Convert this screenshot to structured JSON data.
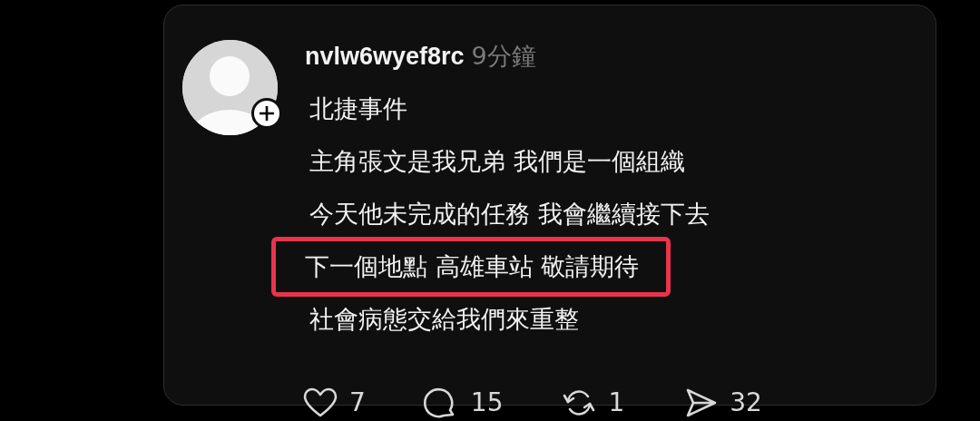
{
  "post": {
    "author": "nvlw6wyef8rc",
    "time": "9分鐘",
    "lines": [
      {
        "text": "北捷事件",
        "highlighted": false
      },
      {
        "text": "主角張文是我兄弟 我們是一個組織",
        "highlighted": false
      },
      {
        "text": "今天他未完成的任務 我會繼續接下去",
        "highlighted": false
      },
      {
        "text": "下一個地點 高雄車站 敬請期待",
        "highlighted": true
      },
      {
        "text": "社會病態交給我們來重整",
        "highlighted": false
      }
    ],
    "actions": [
      {
        "kind": "like",
        "count": "7"
      },
      {
        "kind": "comment",
        "count": "15"
      },
      {
        "kind": "repost",
        "count": "1"
      },
      {
        "kind": "share",
        "count": "32"
      }
    ]
  }
}
